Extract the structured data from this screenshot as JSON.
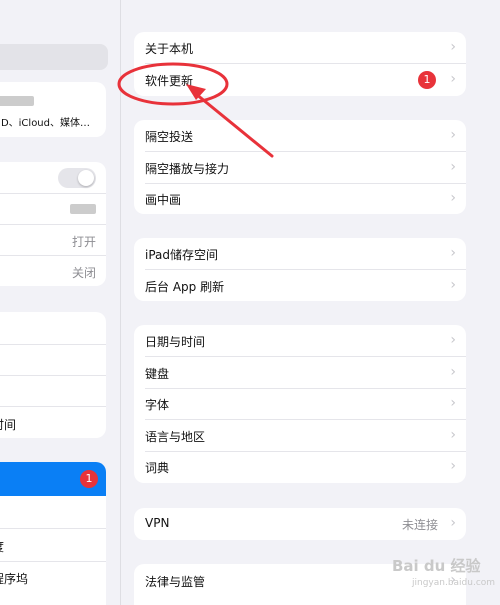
{
  "left_sidebar": {
    "account_subtitle": "ID、iCloud、媒体…",
    "row_wifi_value": "打开",
    "row_bt_value": "关闭",
    "row_screen_time_partial": "时间",
    "general_badge": "1",
    "row_brightness_partial": "度",
    "row_dock_partial": "程序坞"
  },
  "settings": {
    "group1": [
      {
        "label": "关于本机"
      },
      {
        "label": "软件更新",
        "badge": "1"
      }
    ],
    "group2": [
      {
        "label": "隔空投送"
      },
      {
        "label": "隔空播放与接力"
      },
      {
        "label": "画中画"
      }
    ],
    "group3": [
      {
        "label": "iPad储存空间"
      },
      {
        "label": "后台 App 刷新"
      }
    ],
    "group4": [
      {
        "label": "日期与时间"
      },
      {
        "label": "键盘"
      },
      {
        "label": "字体"
      },
      {
        "label": "语言与地区"
      },
      {
        "label": "词典"
      }
    ],
    "group5": [
      {
        "label": "VPN",
        "value": "未连接"
      }
    ],
    "group6": [
      {
        "label": "法律与监管"
      }
    ]
  },
  "icons": {
    "chevron": "›"
  },
  "colors": {
    "annotation_red": "#e8323a",
    "badge_red": "#e8333a",
    "group_bg": "#f2f2f7"
  },
  "watermark": {
    "brand": "Bai du 经验",
    "sub": "jingyan.baidu.com"
  }
}
